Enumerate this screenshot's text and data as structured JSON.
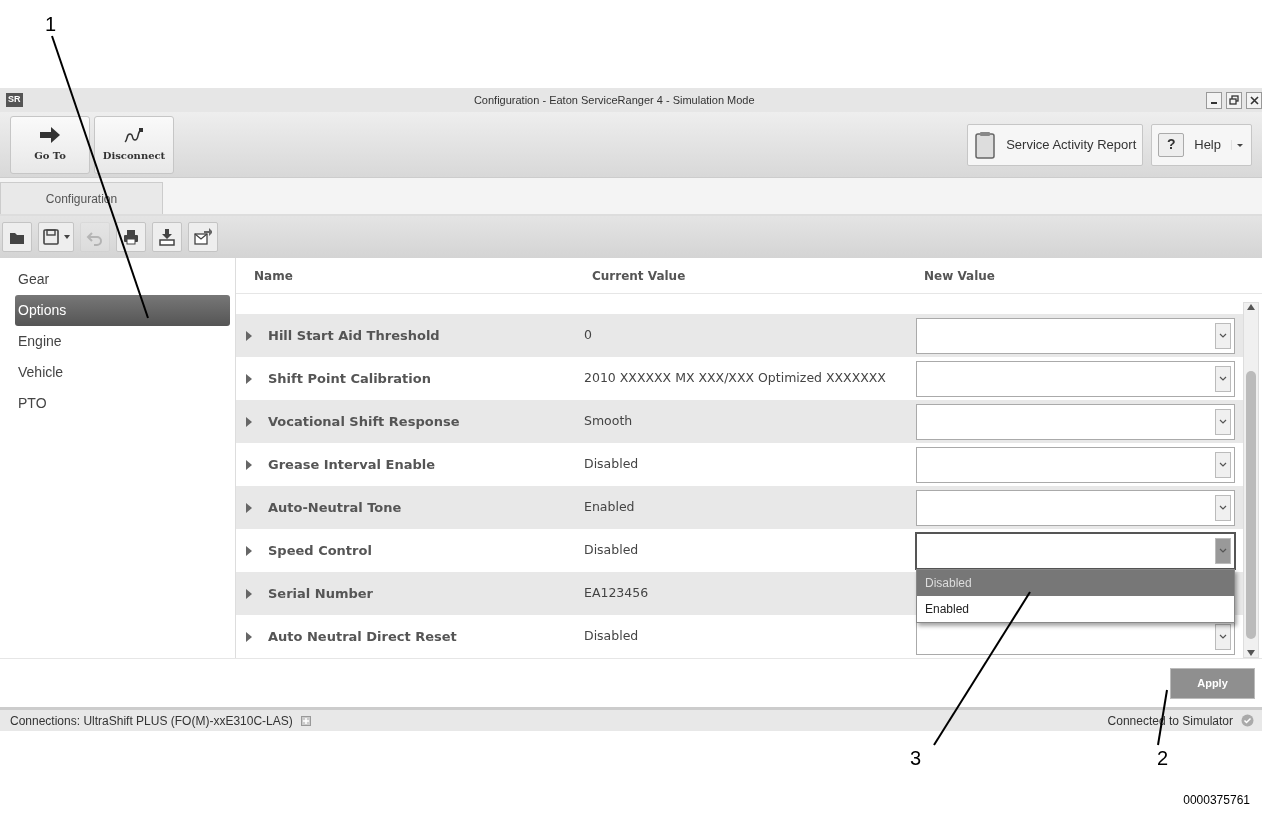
{
  "callouts": [
    {
      "label": "1"
    },
    {
      "label": "2"
    },
    {
      "label": "3"
    }
  ],
  "window": {
    "logo": "SR",
    "title": "Configuration - Eaton ServiceRanger 4 - Simulation Mode"
  },
  "ribbon": {
    "left_buttons": [
      {
        "kind": "goto",
        "label": "Go To"
      },
      {
        "kind": "disconnect",
        "label": "Disconnect"
      }
    ],
    "report_button": "Service Activity Report",
    "help_icon": "?",
    "help_button": "Help"
  },
  "tabs": [
    {
      "label": "Configuration",
      "selected": true
    }
  ],
  "toolbar": [
    {
      "kind": "open",
      "disabled": false
    },
    {
      "kind": "save",
      "disabled": false
    },
    {
      "kind": "undo",
      "disabled": true
    },
    {
      "kind": "print",
      "disabled": false
    },
    {
      "kind": "download",
      "disabled": false
    },
    {
      "kind": "send",
      "disabled": false
    }
  ],
  "sidebar": {
    "items": [
      {
        "label": "Gear",
        "selected": false
      },
      {
        "label": "Options",
        "selected": true
      },
      {
        "label": "Engine",
        "selected": false
      },
      {
        "label": "Vehicle",
        "selected": false
      },
      {
        "label": "PTO",
        "selected": false
      }
    ]
  },
  "table": {
    "columns": [
      "Name",
      "Current Value",
      "New Value"
    ],
    "rows": [
      {
        "name": "Hill Start Aid Threshold",
        "current_value": "0",
        "expanded": false
      },
      {
        "name": "Shift Point Calibration",
        "current_value": "2010 XXXXXX  MX XXX/XXX  Optimized XXXXXXX",
        "expanded": false
      },
      {
        "name": "Vocational Shift Response",
        "current_value": "Smooth",
        "expanded": false
      },
      {
        "name": "Grease Interval Enable",
        "current_value": "Disabled",
        "expanded": false
      },
      {
        "name": "Auto-Neutral Tone",
        "current_value": "Enabled",
        "expanded": false
      },
      {
        "name": "Speed Control",
        "current_value": "Disabled",
        "expanded": true,
        "options": [
          {
            "label": "Disabled",
            "selected": true
          },
          {
            "label": "Enabled",
            "selected": false
          }
        ]
      },
      {
        "name": "Serial Number",
        "current_value": "EA123456",
        "expanded": false
      },
      {
        "name": "Auto Neutral Direct Reset",
        "current_value": "Disabled",
        "expanded": false
      }
    ]
  },
  "apply_button": {
    "label": "Apply",
    "disabled": true
  },
  "status_bar": {
    "connections": "Connections: UltraShift PLUS (FO(M)-xxE310C-LAS)",
    "status": "Connected to Simulator"
  },
  "figure_number": "0000375761"
}
